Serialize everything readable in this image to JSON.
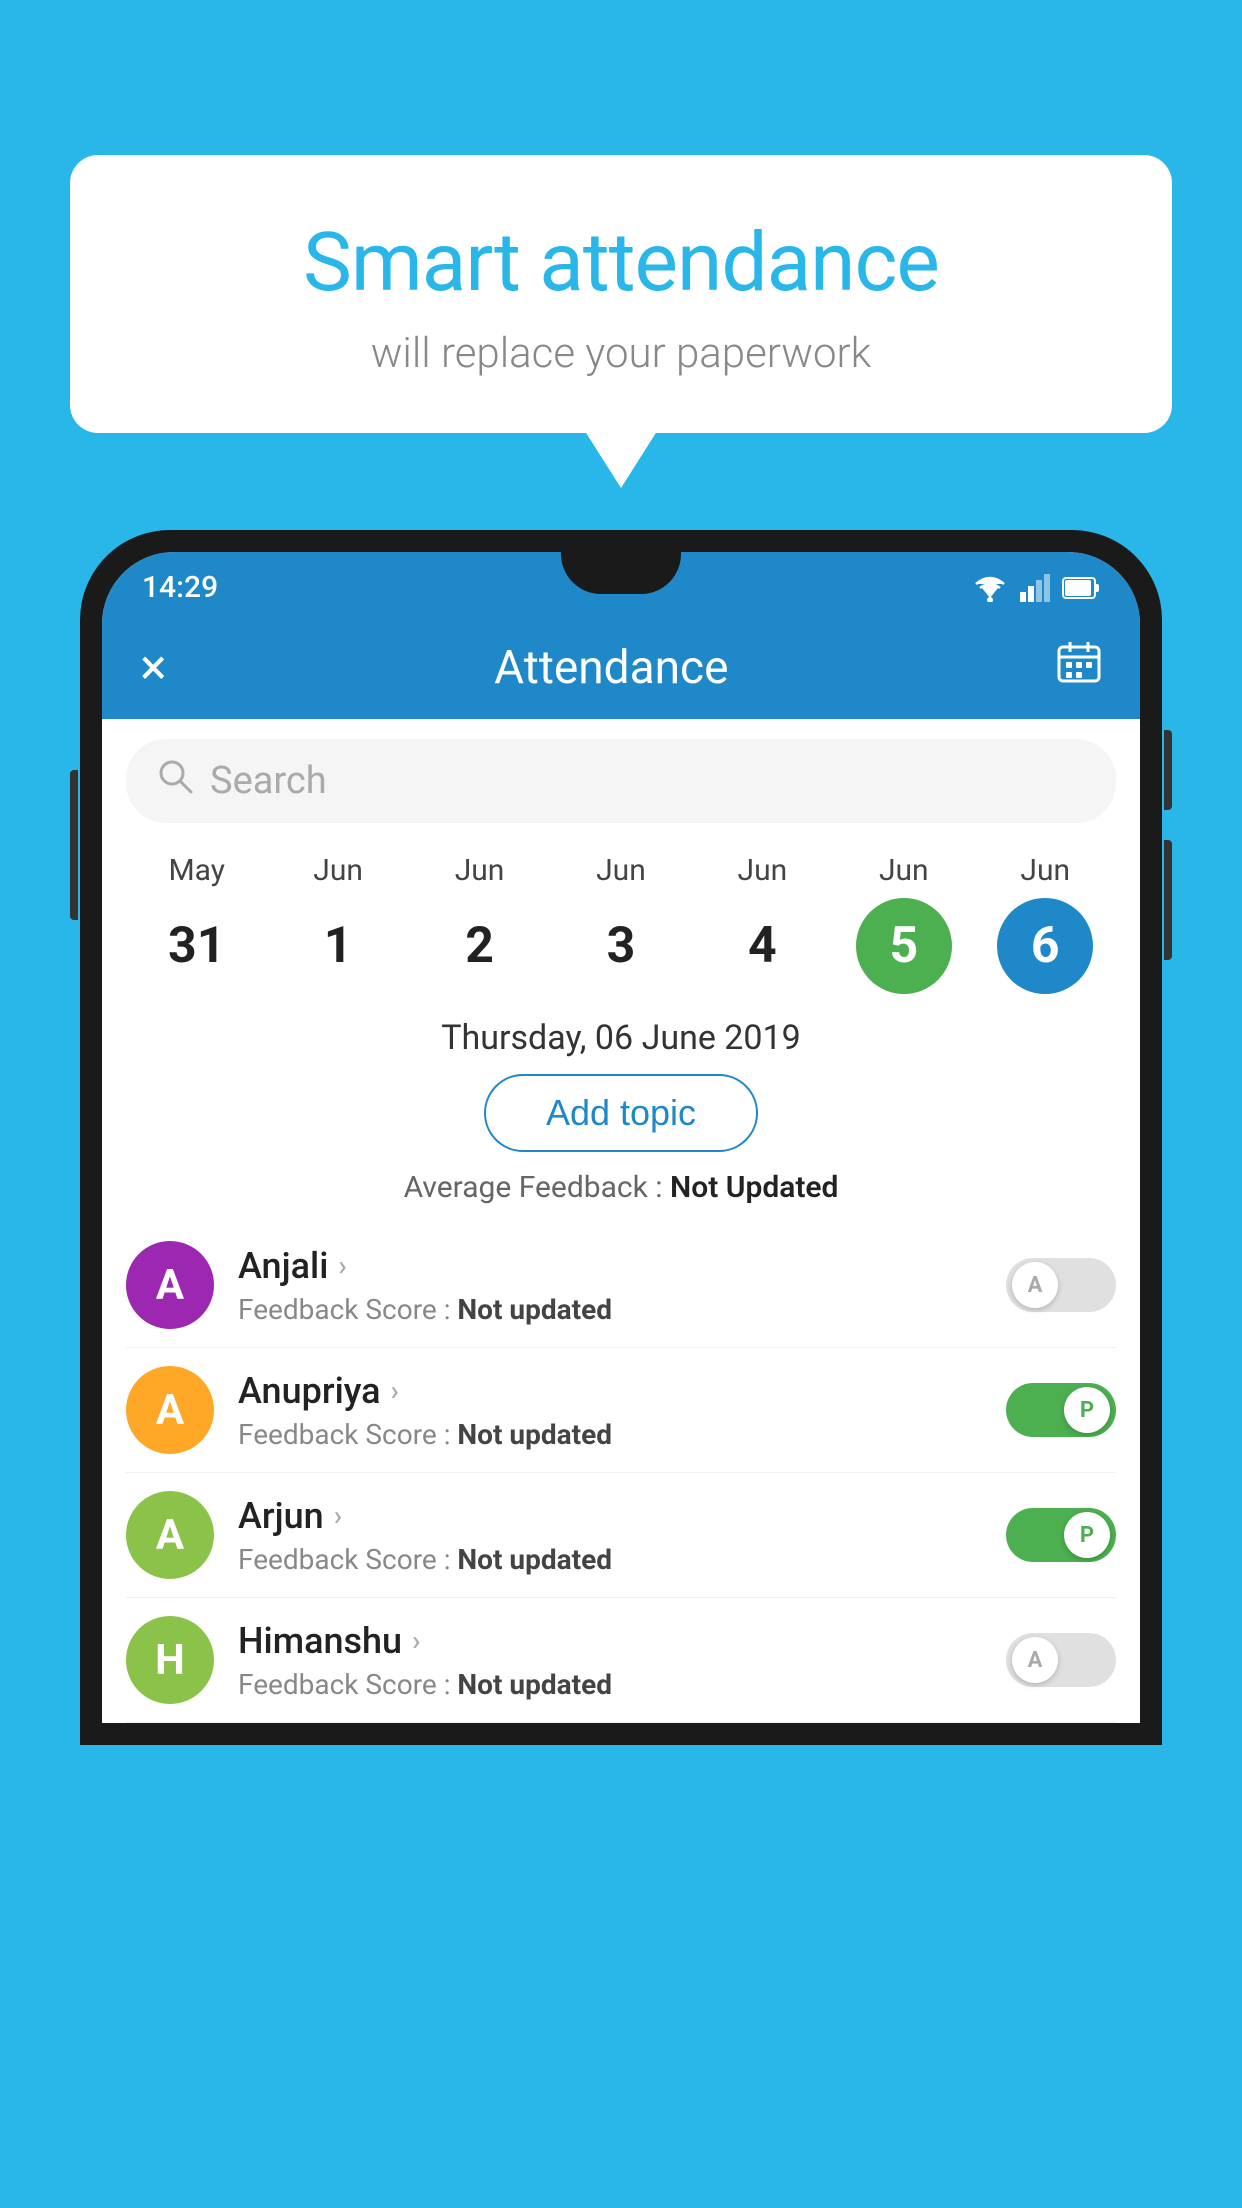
{
  "background_color": "#29b6e8",
  "speech_bubble": {
    "title": "Smart attendance",
    "subtitle": "will replace your paperwork"
  },
  "phone": {
    "status_bar": {
      "time": "14:29"
    },
    "app_bar": {
      "title": "Attendance",
      "close_label": "×",
      "calendar_icon": "📅"
    },
    "search": {
      "placeholder": "Search"
    },
    "calendar": {
      "days": [
        {
          "month": "May",
          "date": "31",
          "state": "normal"
        },
        {
          "month": "Jun",
          "date": "1",
          "state": "normal"
        },
        {
          "month": "Jun",
          "date": "2",
          "state": "normal"
        },
        {
          "month": "Jun",
          "date": "3",
          "state": "normal"
        },
        {
          "month": "Jun",
          "date": "4",
          "state": "normal"
        },
        {
          "month": "Jun",
          "date": "5",
          "state": "today"
        },
        {
          "month": "Jun",
          "date": "6",
          "state": "selected"
        }
      ],
      "selected_date_label": "Thursday, 06 June 2019"
    },
    "add_topic_label": "Add topic",
    "avg_feedback_label": "Average Feedback :",
    "avg_feedback_value": "Not Updated",
    "students": [
      {
        "name": "Anjali",
        "avatar_letter": "A",
        "avatar_color": "#9c27b0",
        "feedback_label": "Feedback Score :",
        "feedback_value": "Not updated",
        "toggle": "off",
        "toggle_letter": "A"
      },
      {
        "name": "Anupriya",
        "avatar_letter": "A",
        "avatar_color": "#ffa726",
        "feedback_label": "Feedback Score :",
        "feedback_value": "Not updated",
        "toggle": "on",
        "toggle_letter": "P"
      },
      {
        "name": "Arjun",
        "avatar_letter": "A",
        "avatar_color": "#8bc34a",
        "feedback_label": "Feedback Score :",
        "feedback_value": "Not updated",
        "toggle": "on",
        "toggle_letter": "P"
      },
      {
        "name": "Himanshu",
        "avatar_letter": "H",
        "avatar_color": "#8bc34a",
        "feedback_label": "Feedback Score :",
        "feedback_value": "Not updated",
        "toggle": "off",
        "toggle_letter": "A"
      }
    ]
  }
}
